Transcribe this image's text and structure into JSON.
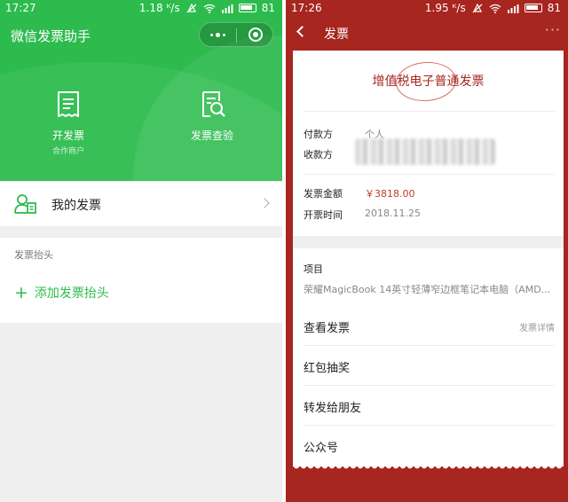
{
  "left": {
    "status": {
      "time": "17:27",
      "speed": "1.18 ᴷ/s",
      "battery": "81"
    },
    "title": "微信发票助手",
    "actions": [
      {
        "label": "开发票",
        "sub": "合作商户",
        "icon": "receipt-icon"
      },
      {
        "label": "发票查验",
        "sub": "",
        "icon": "document-search-icon"
      }
    ],
    "my_invoice": {
      "label": "我的发票",
      "icon": "user-card-icon"
    },
    "invoice_header": {
      "caption": "发票抬头",
      "add_label": "添加发票抬头"
    },
    "colors": {
      "brand": "#2dbb4e"
    }
  },
  "right": {
    "status": {
      "time": "17:26",
      "speed": "1.95 ᴷ/s",
      "battery": "81"
    },
    "nav": {
      "title": "发票",
      "more": "···"
    },
    "invoice": {
      "type_title": "增值税电子普通发票",
      "payer_label": "付款方",
      "payer_value": "个人",
      "payee_label": "收款方",
      "amount_label": "发票金额",
      "amount_value": "￥3818.00",
      "date_label": "开票时间",
      "date_value": "2018.11.25",
      "item_label": "项目",
      "item_value": "荣耀MagicBook 14英寸轻薄窄边框笔记本电脑（AMD..."
    },
    "menu": [
      {
        "label": "查看发票",
        "right": "发票详情"
      },
      {
        "label": "红包抽奖",
        "right": ""
      },
      {
        "label": "转发给朋友",
        "right": ""
      },
      {
        "label": "公众号",
        "right": ""
      }
    ],
    "colors": {
      "brand": "#a7261f",
      "amount": "#c0392b"
    }
  }
}
